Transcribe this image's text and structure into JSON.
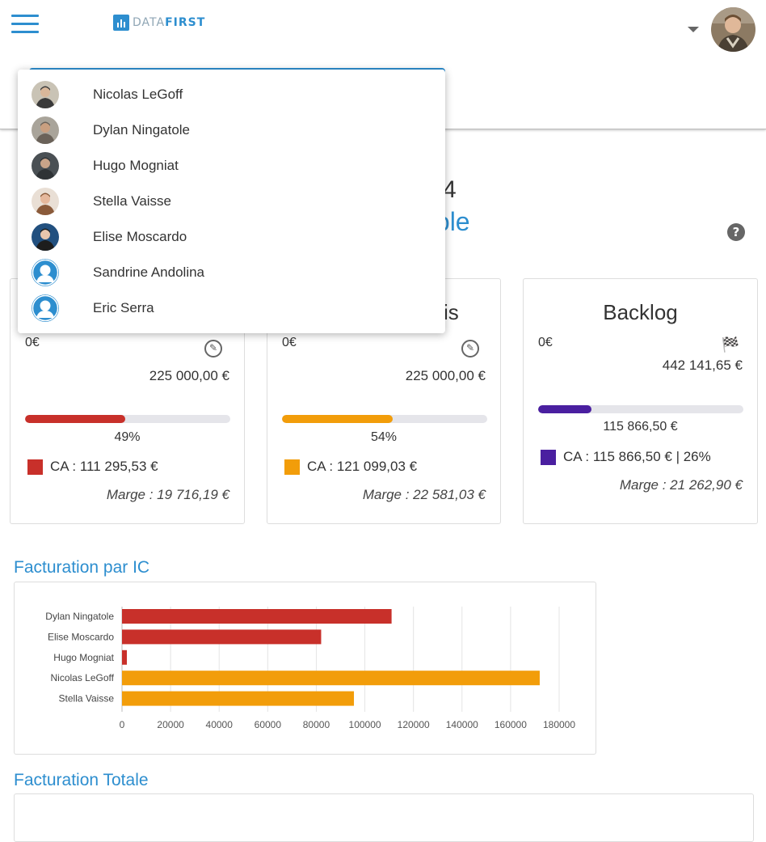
{
  "header": {
    "logo_prefix": "DATA",
    "logo_suffix": "FIRST"
  },
  "dropdown": {
    "items": [
      {
        "label": "Nicolas LeGoff",
        "avatar": "photo"
      },
      {
        "label": "Dylan Ningatole",
        "avatar": "photo"
      },
      {
        "label": "Hugo Mogniat",
        "avatar": "photo"
      },
      {
        "label": "Stella Vaisse",
        "avatar": "photo"
      },
      {
        "label": "Elise Moscardo",
        "avatar": "photo"
      },
      {
        "label": "Sandrine Andolina",
        "avatar": "default-user-icon"
      },
      {
        "label": "Eric Serra",
        "avatar": "default-user-icon"
      }
    ]
  },
  "page": {
    "title_fragment_1": "4",
    "title_fragment_2": "tole"
  },
  "cards": [
    {
      "title_fragment": "",
      "zero": "0€",
      "target": "225 000,00 €",
      "progress": 0.49,
      "pct": "49%",
      "color": "#c8302a",
      "ca": "CA : 111 295,53 €",
      "marge": "Marge : 19 716,19 €"
    },
    {
      "title_fragment": "is",
      "zero": "0€",
      "target": "225 000,00 €",
      "progress": 0.54,
      "pct": "54%",
      "color": "#f29d0a",
      "ca": "CA : 121 099,03 €",
      "marge": "Marge : 22 581,03 €"
    },
    {
      "title": "Backlog",
      "zero": "0€",
      "target": "442 141,65 €",
      "progress": 0.26,
      "amount": "115 866,50 €",
      "color": "#4a1fa0",
      "ca": "CA : 115 866,50 € | 26%",
      "marge": "Marge : 21 262,90 €"
    }
  ],
  "sections": {
    "facturation_ic": "Facturation par IC",
    "facturation_totale": "Facturation Totale"
  },
  "chart_data": {
    "type": "bar",
    "orientation": "horizontal",
    "categories": [
      "Dylan Ningatole",
      "Elise Moscardo",
      "Hugo Mogniat",
      "Nicolas LeGoff",
      "Stella Vaisse"
    ],
    "values": [
      111000,
      82000,
      2000,
      172000,
      95500
    ],
    "colors": [
      "#c8302a",
      "#c8302a",
      "#c8302a",
      "#f29d0a",
      "#f29d0a"
    ],
    "xticks": [
      "0",
      "20000",
      "40000",
      "60000",
      "80000",
      "100000",
      "120000",
      "140000",
      "160000",
      "180000"
    ],
    "xlim": [
      0,
      180000
    ],
    "grid": true,
    "title": "",
    "xlabel": "",
    "ylabel": ""
  }
}
